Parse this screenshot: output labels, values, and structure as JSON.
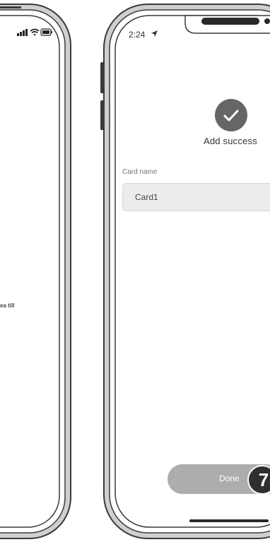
{
  "left_phone": {
    "partial_text": "ea till"
  },
  "right_phone": {
    "status_bar": {
      "time": "2:24"
    },
    "success": {
      "title": "Add success"
    },
    "card_name": {
      "label": "Card name",
      "value": "Card1"
    },
    "done_label": "Done",
    "step_number": "7"
  },
  "icons": [
    "signal-icon",
    "wifi-icon",
    "battery-icon",
    "location-arrow-icon",
    "checkmark-icon"
  ],
  "colors": {
    "frame": "#3a3a3a",
    "bezel": "#cfcfcf",
    "check_circle": "#666666",
    "field_bg": "#ececec",
    "done_button": "#adadad",
    "badge": "#2f2f2f"
  }
}
